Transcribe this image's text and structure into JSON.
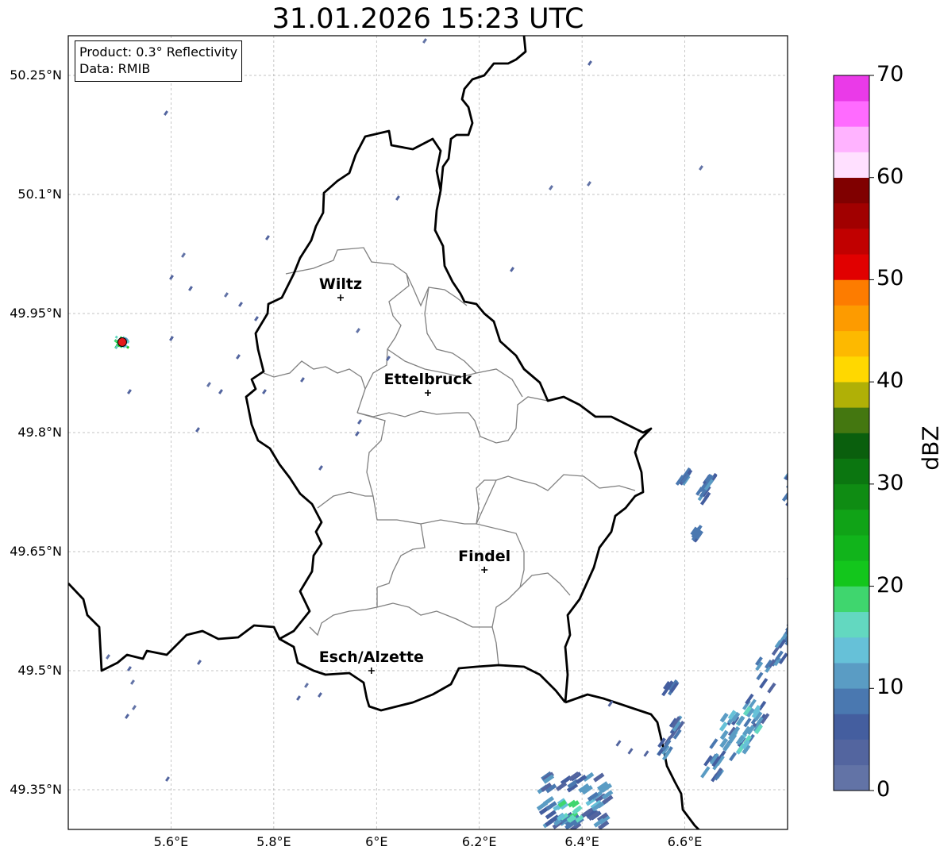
{
  "title": "31.01.2026 15:23 UTC",
  "info": {
    "product": "Product: 0.3° Reflectivity",
    "data": "Data: RMIB"
  },
  "map": {
    "lon_range": [
      5.4,
      6.8
    ],
    "lat_range": [
      49.3,
      50.3
    ],
    "lat_ticks": [
      {
        "value": 50.25,
        "label": "50.25°N"
      },
      {
        "value": 50.1,
        "label": "50.1°N"
      },
      {
        "value": 49.95,
        "label": "49.95°N"
      },
      {
        "value": 49.8,
        "label": "49.8°N"
      },
      {
        "value": 49.65,
        "label": "49.65°N"
      },
      {
        "value": 49.5,
        "label": "49.5°N"
      },
      {
        "value": 49.35,
        "label": "49.35°N"
      }
    ],
    "lon_ticks": [
      {
        "value": 5.6,
        "label": "5.6°E"
      },
      {
        "value": 5.8,
        "label": "5.8°E"
      },
      {
        "value": 6.0,
        "label": "6°E"
      },
      {
        "value": 6.2,
        "label": "6.2°E"
      },
      {
        "value": 6.4,
        "label": "6.4°E"
      },
      {
        "value": 6.6,
        "label": "6.6°E"
      }
    ],
    "cities": [
      {
        "name": "Wiltz",
        "lon": 5.93,
        "lat": 49.97
      },
      {
        "name": "Ettelbruck",
        "lon": 6.1,
        "lat": 49.85
      },
      {
        "name": "Findel",
        "lon": 6.21,
        "lat": 49.627
      },
      {
        "name": "Esch/Alzette",
        "lon": 5.99,
        "lat": 49.5
      }
    ],
    "radar_site": {
      "lon": 5.505,
      "lat": 49.914,
      "color": "#e41a1c"
    }
  },
  "colorbar": {
    "label": "dBZ",
    "min": 0,
    "max": 70,
    "step": 2.5,
    "ticks": [
      {
        "value": 0,
        "label": "0"
      },
      {
        "value": 10,
        "label": "10"
      },
      {
        "value": 20,
        "label": "20"
      },
      {
        "value": 30,
        "label": "30"
      },
      {
        "value": 40,
        "label": "40"
      },
      {
        "value": 50,
        "label": "50"
      },
      {
        "value": 60,
        "label": "60"
      },
      {
        "value": 70,
        "label": "70"
      }
    ],
    "colors": [
      "#6273a6",
      "#53659f",
      "#445e9f",
      "#4a78b0",
      "#5a9cc4",
      "#66c1d8",
      "#63d8c0",
      "#3fd66e",
      "#13c61c",
      "#11b41b",
      "#10a317",
      "#0f8c13",
      "#0b7610",
      "#0a5f0d",
      "#447710",
      "#b0b006",
      "#ffd800",
      "#fdb900",
      "#fd9b00",
      "#fd7c00",
      "#e10000",
      "#c10000",
      "#a10000",
      "#800000",
      "#ffe0ff",
      "#ffb3ff",
      "#ff6bff",
      "#ea3ae8"
    ]
  }
}
